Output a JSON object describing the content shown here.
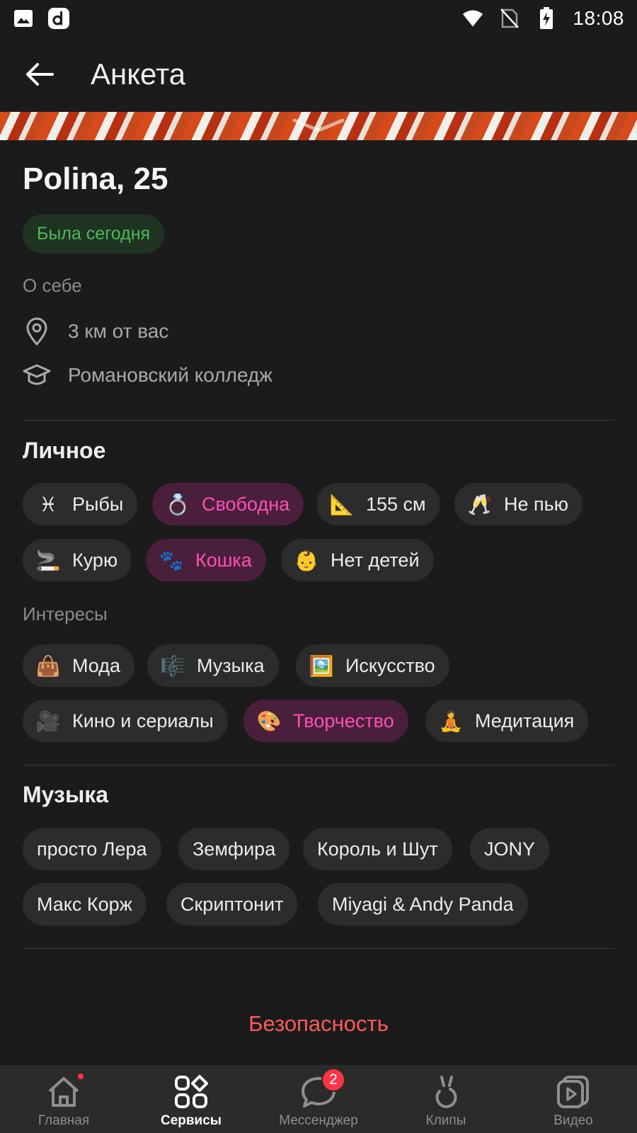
{
  "status_bar": {
    "time": "18:08",
    "icons": [
      "gallery-icon",
      "app-d-icon",
      "wifi-icon",
      "no-sim-icon",
      "battery-charging-icon"
    ]
  },
  "header": {
    "title": "Анкета"
  },
  "profile": {
    "name": "Polina, 25",
    "online_status": "Была сегодня",
    "about_label": "О себе",
    "distance": "3 км от вас",
    "education": "Романовский колледж"
  },
  "personal": {
    "title": "Личное",
    "chips": [
      {
        "emoji": "♓",
        "label": "Рыбы",
        "highlighted": false
      },
      {
        "emoji": "💍",
        "label": "Свободна",
        "highlighted": true
      },
      {
        "emoji": "📐",
        "label": "155 см",
        "highlighted": false
      },
      {
        "emoji": "🥂",
        "label": "Не пью",
        "highlighted": false
      },
      {
        "emoji": "🚬",
        "label": "Курю",
        "highlighted": false
      },
      {
        "emoji": "🐾",
        "label": "Кошка",
        "highlighted": true
      },
      {
        "emoji": "👶",
        "label": "Нет детей",
        "highlighted": false
      }
    ]
  },
  "interests": {
    "title": "Интересы",
    "chips": [
      {
        "emoji": "👜",
        "label": "Мода",
        "highlighted": false
      },
      {
        "emoji": "🎼",
        "label": "Музыка",
        "highlighted": false
      },
      {
        "emoji": "🖼️",
        "label": "Искусство",
        "highlighted": false
      },
      {
        "emoji": "🎥",
        "label": "Кино и сериалы",
        "highlighted": false
      },
      {
        "emoji": "🎨",
        "label": "Творчество",
        "highlighted": true
      },
      {
        "emoji": "🧘",
        "label": "Медитация",
        "highlighted": false
      }
    ]
  },
  "music": {
    "title": "Музыка",
    "artists": [
      "просто Лера",
      "Земфира",
      "Король и Шут",
      "JONY",
      "Макс Корж",
      "Скриптонит",
      "Miyagi & Andy Panda"
    ]
  },
  "security_label": "Безопасность",
  "bottom_nav": {
    "items": [
      {
        "label": "Главная",
        "icon": "home-icon",
        "active": false,
        "dot": true
      },
      {
        "label": "Сервисы",
        "icon": "services-grid-icon",
        "active": true
      },
      {
        "label": "Мессенджер",
        "icon": "chat-bubble-icon",
        "active": false,
        "badge": "2"
      },
      {
        "label": "Клипы",
        "icon": "clips-icon",
        "active": false
      },
      {
        "label": "Видео",
        "icon": "video-play-icon",
        "active": false
      }
    ]
  },
  "colors": {
    "background": "#1b1b1b",
    "chip": "#2c2c2c",
    "highlight_chip_bg": "#4a1f3b",
    "highlight_text": "#ff4fb4",
    "online_text": "#4dba55",
    "danger_text": "#ff5a5a"
  }
}
